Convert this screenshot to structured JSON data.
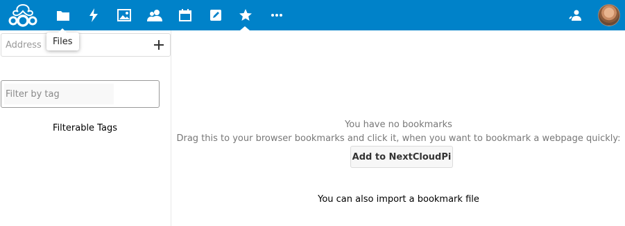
{
  "header": {
    "background_color": "#0082c9",
    "logo_icon": "nextcloud-logo-icon",
    "apps": [
      {
        "name": "Files",
        "icon": "folder-icon"
      },
      {
        "name": "Activity",
        "icon": "lightning-icon"
      },
      {
        "name": "Gallery",
        "icon": "image-icon"
      },
      {
        "name": "Contacts",
        "icon": "contacts-icon"
      },
      {
        "name": "Calendar",
        "icon": "calendar-icon"
      },
      {
        "name": "Notes",
        "icon": "pencil-icon"
      },
      {
        "name": "Bookmarks",
        "icon": "star-icon",
        "active": true
      },
      {
        "name": "More apps",
        "icon": "ellipsis-icon"
      }
    ],
    "contacts_menu_icon": "contacts-menu-icon",
    "avatar_icon": "user-avatar"
  },
  "tooltip": {
    "text": "Files"
  },
  "sidebar": {
    "address_placeholder": "Address",
    "add_icon": "plus-icon",
    "filter_placeholder": "Filter by tag",
    "tags_label": "Filterable Tags"
  },
  "main": {
    "empty_title": "You have no bookmarks",
    "empty_hint": "Drag this to your browser bookmarks and click it, when you want to bookmark a webpage quickly:",
    "bookmarklet_label": "Add to NextCloudPi",
    "import_text": "You can also import a bookmark file"
  }
}
